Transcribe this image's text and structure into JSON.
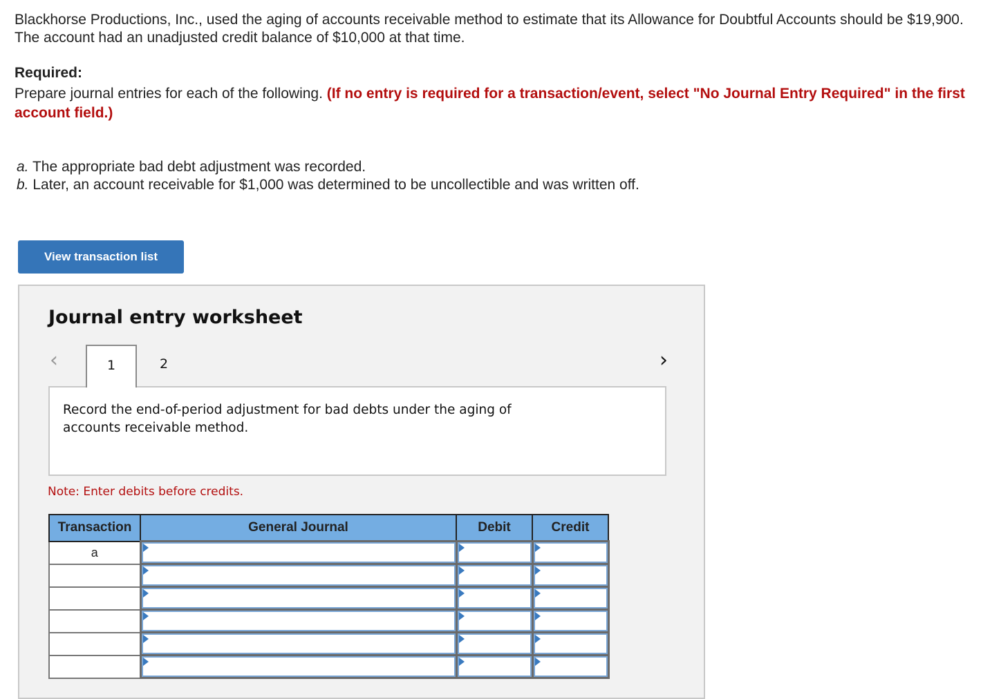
{
  "problem": {
    "intro": "Blackhorse Productions, Inc., used the aging of accounts receivable method to estimate that its Allowance for Doubtful Accounts should be $19,900. The account had an unadjusted credit balance of $10,000 at that time.",
    "required_title": "Required:",
    "required_text": "Prepare journal entries for each of the following.",
    "required_instruction": "(If no entry is required for a transaction/event, select \"No Journal Entry Required\" in the first account field.)",
    "items": [
      {
        "letter": "a.",
        "text": "The appropriate bad debt adjustment was recorded."
      },
      {
        "letter": "b.",
        "text": "Later, an account receivable for $1,000 was determined to be uncollectible and was written off."
      }
    ]
  },
  "buttons": {
    "view_transaction_list": "View transaction list"
  },
  "worksheet": {
    "title": "Journal entry worksheet",
    "prev_icon": "‹",
    "next_icon": "›",
    "tabs": [
      {
        "label": "1",
        "active": true
      },
      {
        "label": "2",
        "active": false
      }
    ],
    "description": "Record the end-of-period adjustment for bad debts under the aging of accounts receivable method.",
    "note": "Note: Enter debits before credits.",
    "table": {
      "headers": [
        "Transaction",
        "General Journal",
        "Debit",
        "Credit"
      ],
      "rows": [
        {
          "transaction": "a",
          "account": "",
          "debit": "",
          "credit": ""
        },
        {
          "transaction": "",
          "account": "",
          "debit": "",
          "credit": ""
        },
        {
          "transaction": "",
          "account": "",
          "debit": "",
          "credit": ""
        },
        {
          "transaction": "",
          "account": "",
          "debit": "",
          "credit": ""
        },
        {
          "transaction": "",
          "account": "",
          "debit": "",
          "credit": ""
        },
        {
          "transaction": "",
          "account": "",
          "debit": "",
          "credit": ""
        }
      ]
    }
  },
  "colors": {
    "accent_button": "#3575b8",
    "instruction_red": "#b30e0e",
    "table_header": "#74ade2",
    "panel_bg": "#f2f2f2"
  }
}
